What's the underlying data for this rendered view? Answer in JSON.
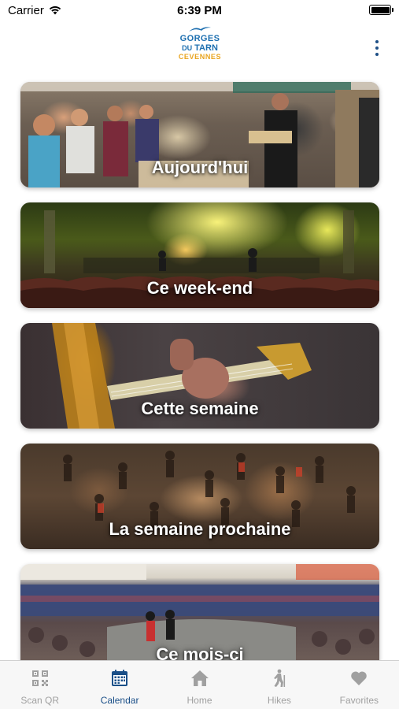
{
  "status_bar": {
    "carrier": "Carrier",
    "time": "6:39 PM",
    "icons": [
      "wifi-icon",
      "battery-icon"
    ]
  },
  "header": {
    "logo": {
      "line1": "GORGES",
      "line2_small": "DU",
      "line2": "TARN",
      "line3": "CEVENNES",
      "colors": {
        "blue": "#1d6fb0",
        "orange": "#e9a41f"
      }
    },
    "menu_icon": "more-vertical-icon"
  },
  "cards": [
    {
      "title": "Aujourd'hui"
    },
    {
      "title": "Ce week-end"
    },
    {
      "title": "Cette semaine"
    },
    {
      "title": "La semaine prochaine"
    },
    {
      "title": "Ce mois-ci"
    }
  ],
  "tab_bar": {
    "active": "Calendar",
    "active_color": "#1a4f88",
    "inactive_color": "#a0a0a0",
    "tabs": [
      {
        "label": "Scan QR",
        "icon": "qr-code-icon"
      },
      {
        "label": "Calendar",
        "icon": "calendar-icon"
      },
      {
        "label": "Home",
        "icon": "home-icon"
      },
      {
        "label": "Hikes",
        "icon": "hiker-icon"
      },
      {
        "label": "Favorites",
        "icon": "heart-icon"
      }
    ]
  }
}
